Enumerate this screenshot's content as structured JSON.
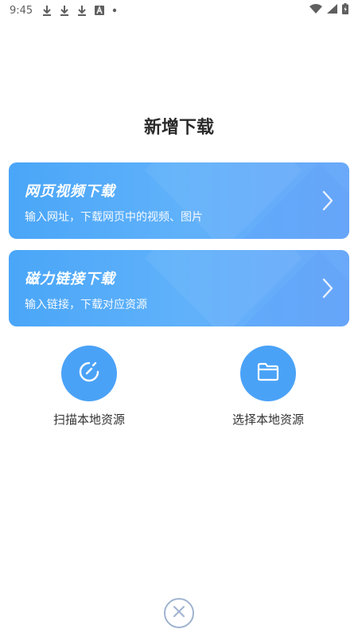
{
  "status_bar": {
    "time": "9:45",
    "icons": [
      "download-icon",
      "download-icon",
      "download-icon",
      "font-icon",
      "dot-icon",
      "wifi-icon",
      "signal-icon",
      "battery-icon"
    ]
  },
  "page": {
    "title": "新增下载"
  },
  "cards": [
    {
      "title": "网页视频下载",
      "subtitle": "输入网址，下载网页中的视频、图片"
    },
    {
      "title": "磁力链接下载",
      "subtitle": "输入链接，下载对应资源"
    }
  ],
  "local": {
    "scan_label": "扫描本地资源",
    "pick_label": "选择本地资源"
  },
  "colors": {
    "accent": "#4aa2f7",
    "card_gradient_start": "#4aa6f8",
    "card_gradient_end": "#6aa9f9",
    "close_border": "#9fb3cf"
  }
}
